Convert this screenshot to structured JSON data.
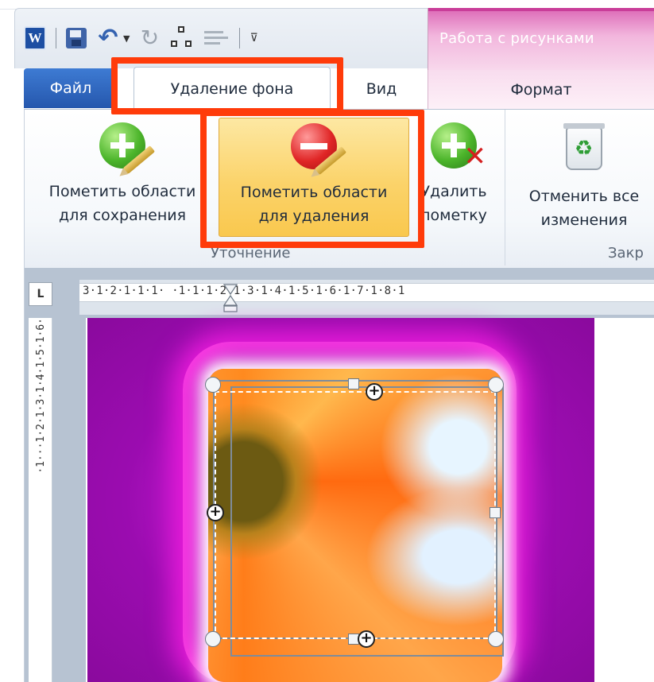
{
  "quick_access": {
    "app_icon": "word-icon",
    "app_letter": "W",
    "items": [
      "save-icon",
      "undo-icon",
      "redo-icon",
      "network-icon",
      "text-box-icon",
      "customize-icon"
    ]
  },
  "context_group": {
    "title": "Работа с рисунками",
    "color": "#dc68b6"
  },
  "tabs": {
    "file": "Файл",
    "background_removal": "Удаление фона",
    "view": "Вид",
    "format": "Формат"
  },
  "ribbon": {
    "buttons": {
      "mark_keep": [
        "Пометить области",
        "для сохранения"
      ],
      "mark_remove": [
        "Пометить области",
        "для удаления"
      ],
      "delete_mark": [
        "Удалить",
        "пометку"
      ],
      "discard_all": [
        "Отменить все",
        "изменения"
      ]
    },
    "groups": {
      "refine": "Уточнение",
      "close": "Закр"
    }
  },
  "ruler": {
    "corner": "L",
    "horizontal": "3·1·2·1·1·1· ·1·1·1·2·1·3·1·4·1·5·1·6·1·7·1·8·1",
    "vertical": "·1···1·2·1·3·1·4·1·5·1·6·"
  },
  "colors": {
    "annotation": "#ff3b0a",
    "file_tab": "#2b5fb5",
    "highlight": "#fbd36a",
    "picture_background": "#9b0cb0"
  }
}
